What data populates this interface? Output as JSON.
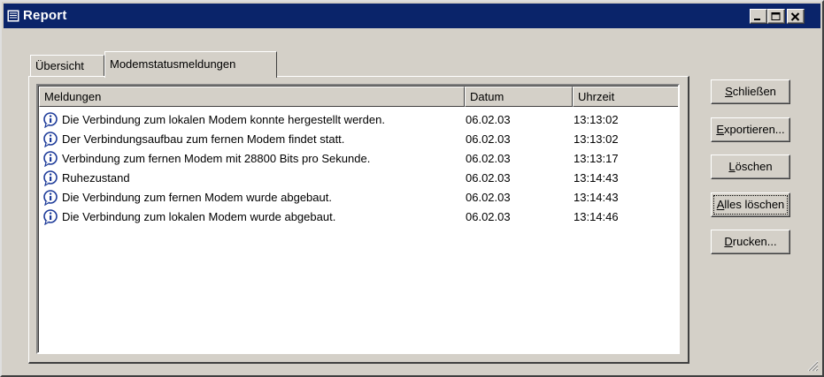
{
  "window": {
    "title": "Report"
  },
  "tabs": [
    {
      "label": "Übersicht",
      "active": false
    },
    {
      "label": "Modemstatusmeldungen",
      "active": true
    }
  ],
  "list": {
    "columns": [
      "Meldungen",
      "Datum",
      "Uhrzeit"
    ],
    "rows": [
      {
        "icon": "info-icon",
        "message": "Die Verbindung zum lokalen Modem konnte hergestellt werden.",
        "date": "06.02.03",
        "time": "13:13:02"
      },
      {
        "icon": "info-icon",
        "message": "Der Verbindungsaufbau zum fernen Modem findet statt.",
        "date": "06.02.03",
        "time": "13:13:02"
      },
      {
        "icon": "info-icon",
        "message": "Verbindung zum fernen Modem mit 28800 Bits pro Sekunde.",
        "date": "06.02.03",
        "time": "13:13:17"
      },
      {
        "icon": "info-icon",
        "message": "Ruhezustand",
        "date": "06.02.03",
        "time": "13:14:43"
      },
      {
        "icon": "info-icon",
        "message": "Die Verbindung zum fernen Modem wurde abgebaut.",
        "date": "06.02.03",
        "time": "13:14:43"
      },
      {
        "icon": "info-icon",
        "message": "Die Verbindung zum lokalen Modem wurde abgebaut.",
        "date": "06.02.03",
        "time": "13:14:46"
      }
    ]
  },
  "buttons": {
    "close": {
      "accel": "S",
      "rest": "chließen"
    },
    "export": {
      "accel": "E",
      "rest": "xportieren..."
    },
    "delete": {
      "accel": "L",
      "rest": "öschen"
    },
    "delete_all": {
      "accel": "A",
      "rest": "lles löschen"
    },
    "print": {
      "accel": "D",
      "rest": "rucken..."
    }
  }
}
